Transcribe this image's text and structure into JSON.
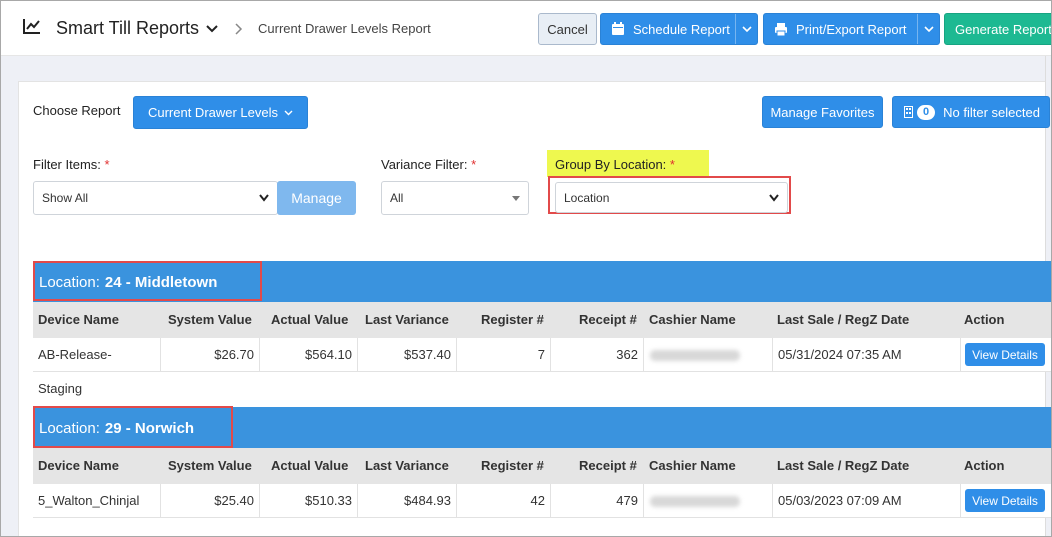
{
  "header": {
    "app_title": "Smart Till Reports",
    "breadcrumb": "Current Drawer Levels Report",
    "cancel_label": "Cancel",
    "schedule_label": "Schedule Report",
    "print_label": "Print/Export Report",
    "generate_label": "Generate Report"
  },
  "controls": {
    "choose_report_label": "Choose Report",
    "report_button_label": "Current Drawer Levels",
    "manage_favorites_label": "Manage Favorites",
    "filter_count": "0",
    "filter_label": "No filter selected",
    "filter_items_label": "Filter Items:",
    "filter_items_value": "Show All",
    "manage_label": "Manage",
    "variance_label": "Variance Filter:",
    "variance_value": "All",
    "group_label": "Group By Location:",
    "group_value": "Location",
    "required_mark": "*"
  },
  "columns": [
    "Device Name",
    "System Value",
    "Actual Value",
    "Last Variance",
    "Register #",
    "Receipt #",
    "Cashier Name",
    "Last Sale / RegZ Date",
    "Action"
  ],
  "groups": [
    {
      "prefix": "Location:",
      "name": "24 - Middletown",
      "row": {
        "device": "AB-Release-Staging",
        "system_value": "$26.70",
        "actual_value": "$564.10",
        "last_variance": "$537.40",
        "register": "7",
        "receipt": "362",
        "last_sale": "05/31/2024 07:35 AM",
        "action": "View Details"
      }
    },
    {
      "prefix": "Location:",
      "name": "29 - Norwich",
      "row": {
        "device": "5_Walton_Chinjal",
        "system_value": "$25.40",
        "actual_value": "$510.33",
        "last_variance": "$484.93",
        "register": "42",
        "receipt": "479",
        "last_sale": "05/03/2023 07:09 AM",
        "action": "View Details"
      }
    }
  ],
  "colors": {
    "primary": "#2f8ee8",
    "success": "#1db992",
    "location_bar": "#3a93de",
    "highlight": "#eef84f",
    "annotation": "#e24a4a"
  }
}
